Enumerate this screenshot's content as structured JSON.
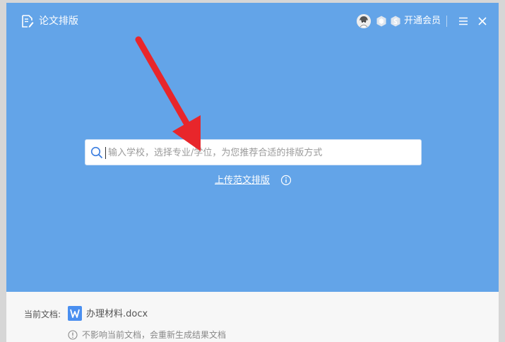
{
  "titlebar": {
    "app_title": "论文排版",
    "app_icon": "document-edit-icon",
    "vip_label": "开通会员",
    "avatar": "user-avatar",
    "badges": [
      "membership-badge-icon",
      "level-badge-icon"
    ],
    "menu_icon": "hamburger-menu-icon",
    "close_icon": "close-icon"
  },
  "search": {
    "placeholder": "输入学校，选择专业/学位，为您推荐合适的排版方式",
    "value": "",
    "icon": "search-icon"
  },
  "upload": {
    "label": "上传范文排版",
    "info_icon": "info-icon"
  },
  "footer": {
    "current_doc_label": "当前文档:",
    "doc_icon": "word-document-icon",
    "doc_name": "办理材料.docx",
    "note_icon": "info-icon",
    "note": "不影响当前文档，会重新生成结果文档"
  },
  "colors": {
    "main_background": "#63a4e8",
    "footer_background": "#f7f7f7",
    "arrow": "#e8262b",
    "word_icon": "#4a8ff0"
  }
}
